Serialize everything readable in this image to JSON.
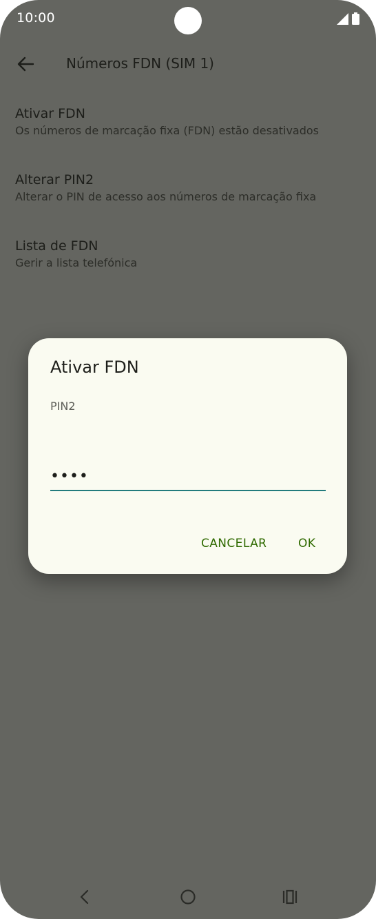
{
  "status_bar": {
    "time": "10:00",
    "icons": [
      "camera-cutout",
      "cell-signal-icon",
      "battery-icon"
    ]
  },
  "app_bar": {
    "back_icon": "back-arrow-icon",
    "title": "Números FDN (SIM 1)"
  },
  "settings": {
    "items": [
      {
        "title": "Ativar FDN",
        "subtitle": "Os números de marcação fixa (FDN) estão desativados"
      },
      {
        "title": "Alterar PIN2",
        "subtitle": "Alterar o PIN de acesso aos números de marcação fixa"
      },
      {
        "title": "Lista de FDN",
        "subtitle": "Gerir a lista telefónica"
      }
    ]
  },
  "dialog": {
    "title": "Ativar FDN",
    "field_label": "PIN2",
    "field_value": "••••",
    "cancel_label": "CANCELAR",
    "ok_label": "OK"
  },
  "nav_bar": {
    "icons": [
      "nav-back-icon",
      "nav-home-icon",
      "nav-recents-icon"
    ]
  },
  "colors": {
    "background_dim": "#646560",
    "dialog_bg": "#fafbf1",
    "accent_button": "#2f6a00",
    "input_underline": "#227b7d"
  }
}
